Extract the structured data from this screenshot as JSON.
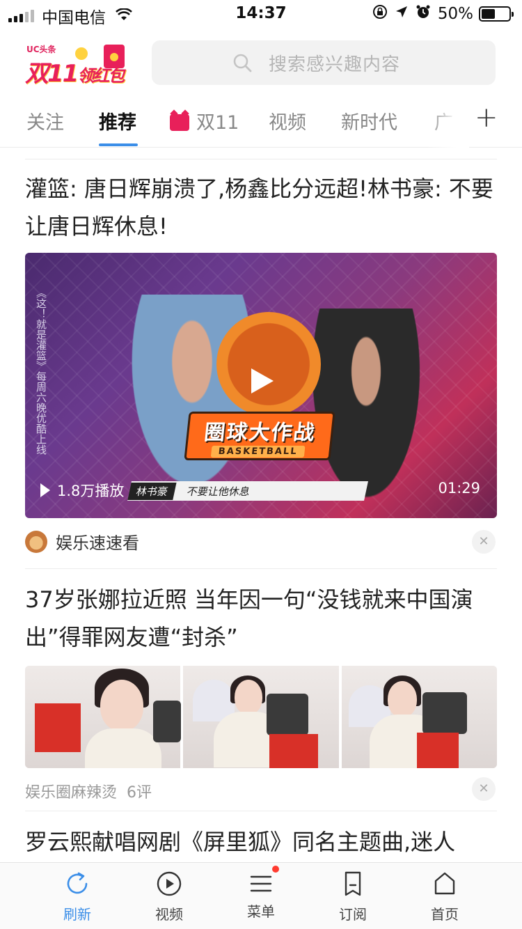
{
  "status_bar": {
    "carrier": "中国电信",
    "time": "14:37",
    "battery_percent": "50%",
    "battery_level": 0.5
  },
  "header": {
    "logo_top": "UC头条",
    "logo_main": "双11",
    "logo_sub": "领红包",
    "search_placeholder": "搜索感兴趣内容"
  },
  "tabs": [
    {
      "label": "关注",
      "active": false
    },
    {
      "label": "推荐",
      "active": true
    },
    {
      "label": "双11",
      "active": false,
      "icon": "gift-icon"
    },
    {
      "label": "视频",
      "active": false
    },
    {
      "label": "新时代",
      "active": false
    },
    {
      "label": "广",
      "active": false
    }
  ],
  "articles": [
    {
      "title": "灌篮: 唐日辉崩溃了,杨鑫比分远超!林书豪: 不要让唐日辉休息!",
      "video": {
        "side_text": "《这！就是灌篮》每周六晚优酷上线",
        "brand_title": "圈球大作战",
        "brand_sub": "BASKETBALL",
        "banner_name": "林书豪",
        "banner_text": "不要让他休息",
        "plays": "1.8万播放",
        "duration": "01:29"
      },
      "source": "娱乐速速看"
    },
    {
      "title": "37岁张娜拉近照 当年因一句“没钱就来中国演出”得罪网友遭“封杀”",
      "source": "娱乐圈麻辣烫",
      "comments": "6评"
    },
    {
      "title": "罗云熙献唱网剧《屏里狐》同名主题曲,迷人"
    }
  ],
  "bottom_nav": [
    {
      "label": "刷新",
      "icon": "refresh-icon",
      "active": true
    },
    {
      "label": "视频",
      "icon": "play-circle-icon",
      "active": false
    },
    {
      "label": "菜单",
      "icon": "menu-icon",
      "active": false,
      "badge": true
    },
    {
      "label": "订阅",
      "icon": "bookmark-icon",
      "active": false
    },
    {
      "label": "首页",
      "icon": "home-icon",
      "active": false
    }
  ],
  "colors": {
    "accent": "#3b8ee8",
    "brand_red": "#e8205a",
    "badge": "#ff3b30"
  }
}
